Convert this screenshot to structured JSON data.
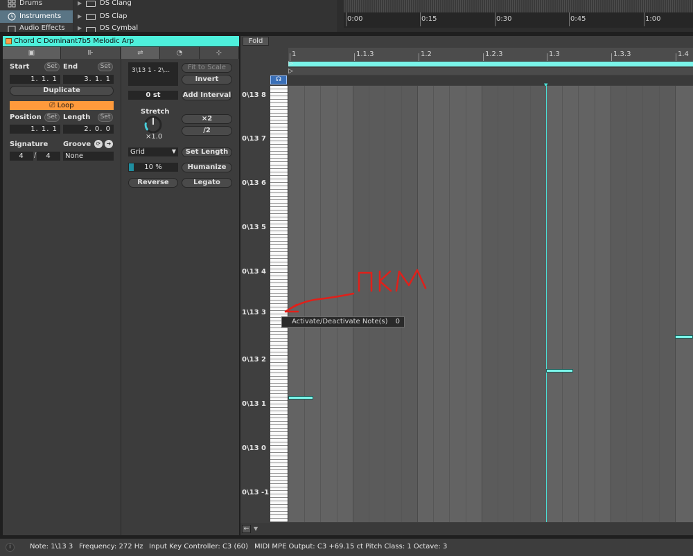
{
  "browser": {
    "categories": [
      {
        "label": "Drums",
        "icon": "grid-icon"
      },
      {
        "label": "Instruments",
        "icon": "clock-icon"
      },
      {
        "label": "Audio Effects",
        "icon": "effects-icon"
      }
    ],
    "files": [
      {
        "label": "DS Clang"
      },
      {
        "label": "DS Clap"
      },
      {
        "label": "DS Cymbal"
      }
    ],
    "timeline_labels": [
      "0:00",
      "0:15",
      "0:30",
      "0:45",
      "1:00"
    ]
  },
  "clip": {
    "title": "Chord C Dominant7b5 Melodic Arp",
    "title_color": "#4ef0dc",
    "swatch_color": "#ffa04a",
    "start_label": "Start",
    "end_label": "End",
    "set_label": "Set",
    "start_value": "1.  1.  1",
    "end_value": "3.  1.  1",
    "duplicate_label": "Duplicate",
    "loop_label": "Loop",
    "position_label": "Position",
    "length_label": "Length",
    "position_value": "1.  1.  1",
    "length_value": "2.  0.  0",
    "signature_label": "Signature",
    "groove_label": "Groove",
    "sig_num": "4",
    "sig_den": "4",
    "groove_value": "None"
  },
  "notes_panel": {
    "selection": "3\\13 1 - 2\\...",
    "fit_to_scale": "Fit to Scale",
    "invert": "Invert",
    "transpose": "0 st",
    "add_interval": "Add Interval",
    "stretch_label": "Stretch",
    "stretch_value": "×1.0",
    "x2": "×2",
    "div2": "/2",
    "grid_label": "Grid",
    "set_length": "Set Length",
    "humanize_value": "10 %",
    "humanize": "Humanize",
    "reverse": "Reverse",
    "legato": "Legato"
  },
  "editor": {
    "fold_label": "Fold",
    "ruler_labels": [
      "1",
      "1.1.3",
      "1.2",
      "1.2.3",
      "1.3",
      "1.3.3",
      "1.4"
    ],
    "pitch_labels": [
      "0\\13 8",
      "0\\13 7",
      "0\\13 6",
      "0\\13 5",
      "0\\13 4",
      "1\\13 3",
      "0\\13 2",
      "0\\13 1",
      "0\\13 0",
      "0\\13 -1"
    ],
    "note_color": "#7af5ea"
  },
  "context_menu": {
    "item_label": "Activate/Deactivate Note(s)",
    "shortcut": "0"
  },
  "annotation": {
    "text": "ПКМ",
    "color": "#e0201a"
  },
  "status": {
    "note": "Note: 1\\13 3",
    "frequency": "Frequency: 272 Hz",
    "input_key": "Input Key Controller: C3 (60)",
    "mpe_output": "MIDI MPE Output: C3 +69.15 ct",
    "pitch_class": "Pitch Class: 1 Octave: 3"
  }
}
